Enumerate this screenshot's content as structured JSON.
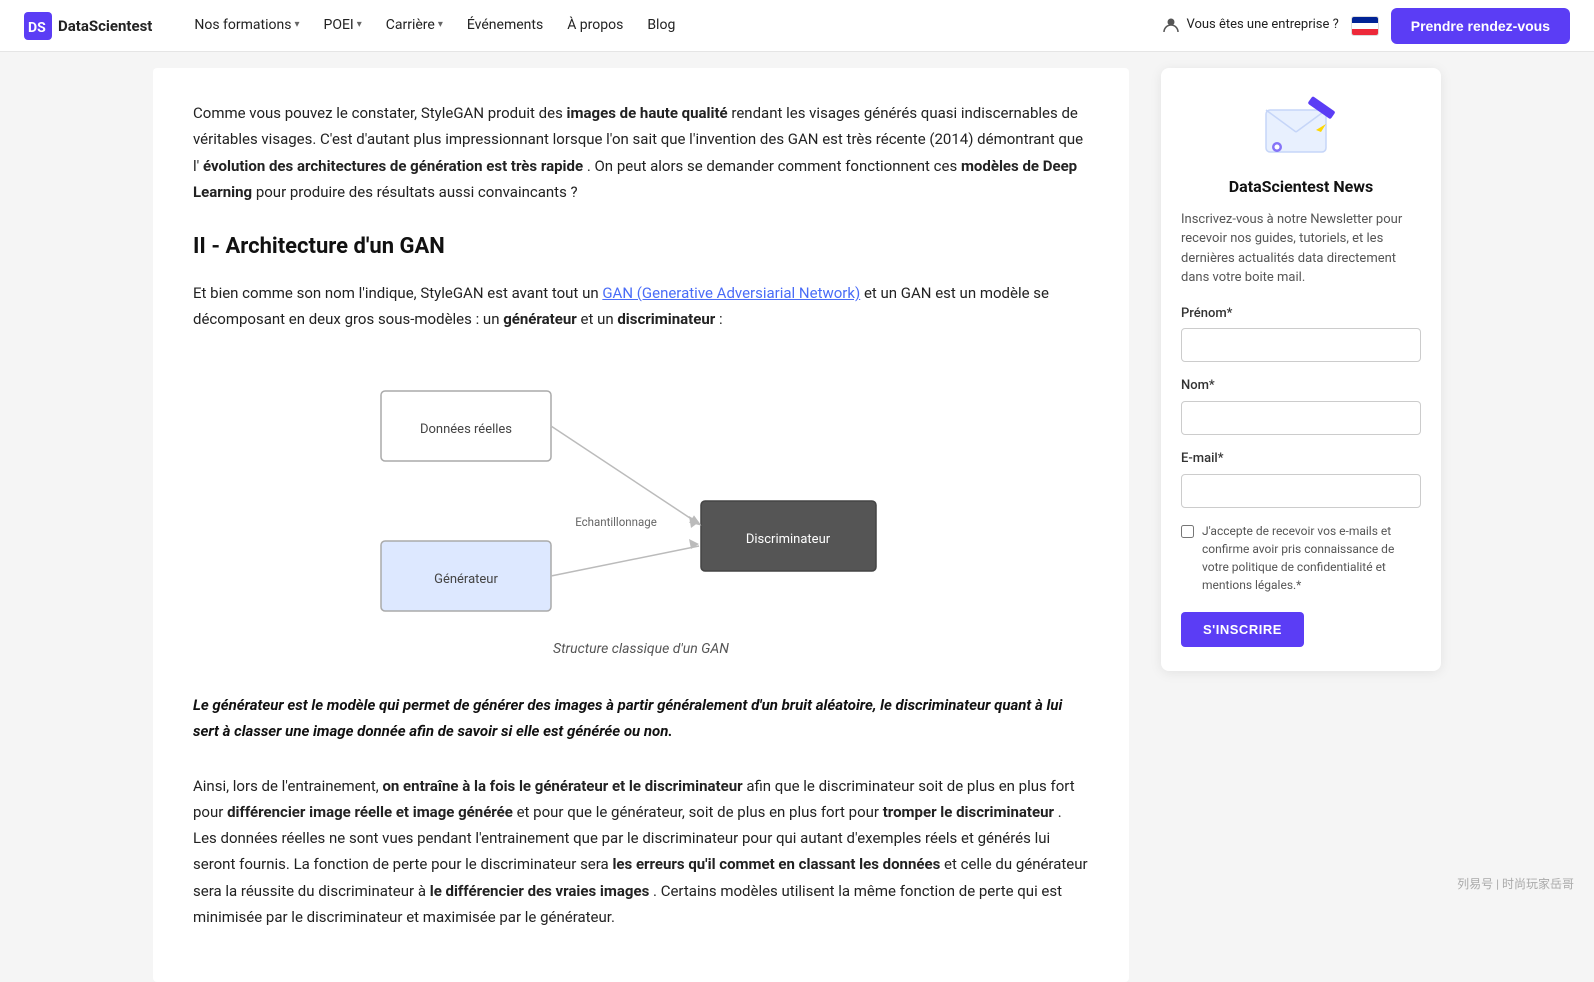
{
  "navbar": {
    "logo_text": "DataScientest",
    "nav_items": [
      {
        "label": "Nos formations",
        "has_dropdown": true
      },
      {
        "label": "POEI",
        "has_dropdown": true
      },
      {
        "label": "Carrière",
        "has_dropdown": true
      },
      {
        "label": "Événements",
        "has_dropdown": false
      },
      {
        "label": "À propos",
        "has_dropdown": false
      },
      {
        "label": "Blog",
        "has_dropdown": false
      }
    ],
    "enterprise_label": "Vous êtes une entreprise ?",
    "cta_label": "Prendre rendez-vous"
  },
  "article": {
    "intro": {
      "text1": "Comme vous pouvez le constater, StyleGAN produit des ",
      "bold1": "images de haute qualité",
      "text2": " rendant les visages générés quasi indiscernables de véritables visages. C'est d'autant plus impressionnant lorsque l'on sait que l'invention des GAN est très récente (2014) démontrant que l'",
      "bold2": "évolution des architectures de génération est très rapide",
      "text3": ". On peut alors se demander comment fonctionnent ces ",
      "bold3": "modèles de Deep Learning",
      "text4": " pour produire des résultats aussi convaincants ?"
    },
    "section_title": "II - Architecture d'un GAN",
    "section_intro": {
      "text1": "Et bien comme son nom l'indique, StyleGAN est avant tout un ",
      "link_text": "GAN (Generative Adversiarial Network)",
      "text2": " et un GAN est un modèle se décomposant en deux gros sous-modèles : un ",
      "bold1": "générateur",
      "text3": " et un ",
      "bold2": "discriminateur",
      "text4": " :"
    },
    "diagram_caption": "Structure classique d'un GAN",
    "diagram_labels": {
      "data_reelles": "Données réelles",
      "echantillonnage": "Echantillonnage",
      "discriminateur": "Discriminateur",
      "generateur": "Générateur"
    },
    "highlight_text": "Le générateur est le modèle qui permet de générer des images à partir généralement d'un bruit aléatoire, le discriminateur quant à lui sert à classer une image donnée afin de savoir si elle est générée ou non.",
    "body_paragraph": {
      "text1": "Ainsi, lors de l'entrainement, ",
      "bold1": "on entraîne à la fois le générateur et le discriminateur",
      "text2": " afin que le discriminateur soit de plus en plus fort pour ",
      "bold2": "différencier image réelle et image générée",
      "text3": " et pour que le générateur, soit de plus en plus fort pour ",
      "bold3": "tromper le discriminateur",
      "text4": ". Les données réelles ne sont vues pendant l'entrainement que par le discriminateur pour qui autant d'exemples réels et générés lui seront fournis. La fonction de perte pour le discriminateur sera ",
      "bold4": "les erreurs qu'il commet en classant les données",
      "text5": " et celle du générateur sera la réussite du discriminateur à ",
      "bold5": "le différencier des vraies images",
      "text6": ". Certains modèles utilisent la même fonction de perte qui est minimisée par le discriminateur et maximisée par le générateur."
    }
  },
  "newsletter": {
    "title": "DataScientest News",
    "description": "Inscrivez-vous à notre Newsletter pour recevoir nos guides, tutoriels, et les dernières actualités data directement dans votre boite mail.",
    "prenom_label": "Prénom*",
    "prenom_placeholder": "",
    "nom_label": "Nom*",
    "nom_placeholder": "",
    "email_label": "E-mail*",
    "email_placeholder": "",
    "checkbox_label": "J'accepte de recevoir vos e-mails et confirme avoir pris connaissance de votre politique de confidentialité et mentions légales.*",
    "subscribe_label": "S'INSCRIRE"
  },
  "watermark": "列易号 | 时尚玩家岳哥"
}
